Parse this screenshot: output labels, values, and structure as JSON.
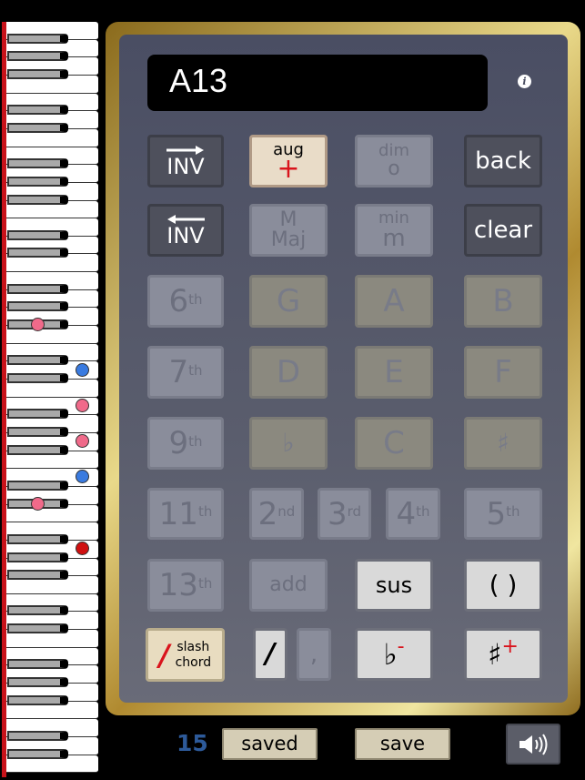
{
  "display": {
    "chord": "A13"
  },
  "info_icon": "info-icon",
  "buttons": {
    "inv_up": "INV",
    "aug": "aug",
    "aug_symbol": "+",
    "dim": "dim",
    "dim_symbol": "o",
    "back": "back",
    "inv_down": "INV",
    "maj": "M",
    "maj_word": "Maj",
    "min": "min",
    "min_symbol": "m",
    "clear": "clear",
    "sixth": "6",
    "sixth_sup": "th",
    "g": "G",
    "a": "A",
    "b": "B",
    "seventh": "7",
    "seventh_sup": "th",
    "d": "D",
    "e": "E",
    "f": "F",
    "ninth": "9",
    "ninth_sup": "th",
    "flat_note": "♭",
    "c": "C",
    "sharp_note": "♯",
    "eleventh": "11",
    "eleventh_sup": "th",
    "second": "2",
    "second_sup": "nd",
    "third": "3",
    "third_sup": "rd",
    "fourth": "4",
    "fourth_sup": "th",
    "fifth": "5",
    "fifth_sup": "th",
    "thirteenth": "13",
    "thirteenth_sup": "th",
    "add": "add",
    "sus": "sus",
    "parens": "( )",
    "slash_symbol": "/",
    "slash_word1": "slash",
    "slash_word2": "chord",
    "slash": "/",
    "comma": ",",
    "flat": "♭",
    "flat_sup": "-",
    "sharp": "♯",
    "sharp_sup": "+"
  },
  "button_states": {
    "aug": "active",
    "dim": "disabled",
    "maj": "disabled",
    "min": "disabled",
    "extensions": "disabled",
    "note_keys": "disabled",
    "add": "disabled",
    "comma": "disabled",
    "sus": "enabled",
    "parens": "enabled",
    "slash": "enabled",
    "flat": "enabled",
    "sharp": "enabled"
  },
  "footer": {
    "count": "15",
    "saved": "saved",
    "save": "save",
    "speaker_icon": "speaker-icon"
  },
  "keyboard": {
    "highlighted_notes": [
      {
        "color": "pink"
      },
      {
        "color": "blue"
      },
      {
        "color": "pink"
      },
      {
        "color": "pink"
      },
      {
        "color": "blue"
      },
      {
        "color": "pink"
      },
      {
        "color": "red"
      }
    ]
  },
  "colors": {
    "accent_red": "#d9141c",
    "pink": "#f06a8a",
    "blue": "#3a7be0",
    "red": "#d01010",
    "count_blue": "#2d5a9a",
    "gold": "#d8c070"
  }
}
